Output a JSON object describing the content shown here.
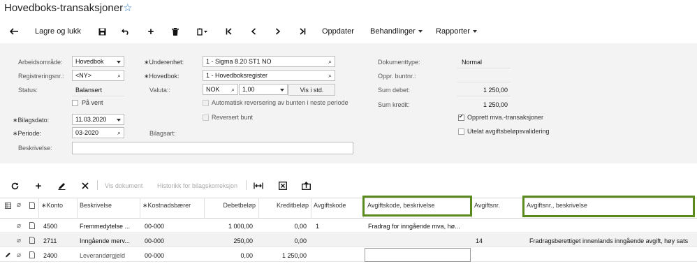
{
  "header": {
    "title": "Hovedboks-transaksjoner"
  },
  "toolbar": {
    "save_close": "Lagre og lukk",
    "update": "Oppdater",
    "actions": "Behandlinger",
    "reports": "Rapporter"
  },
  "form": {
    "workspace_label": "Arbeidsområde:",
    "workspace_value": "Hovedbok",
    "regno_label": "Registreringsnr.:",
    "regno_value": "<NY>",
    "status_label": "Status:",
    "status_value": "Balansert",
    "onhold_label": "På vent",
    "date_label": "Bilagsdato:",
    "date_value": "11.03.2020",
    "period_label": "Periode:",
    "period_value": "03-2020",
    "desc_label": "Beskrivelse:",
    "desc_value": "",
    "subunit_label": "Underenhet:",
    "subunit_value": "1 - Sigma 8.20 ST1 NO",
    "ledger_label": "Hovedbok:",
    "ledger_value": "1 - Hovedboksregister",
    "currency_label": "Valuta::",
    "currency_value": "NOK",
    "rate_value": "1,00",
    "view_std": "Vis i std.",
    "auto_reverse": "Automatisk reversering av bunten i neste periode",
    "reversed": "Reversert bunt",
    "voucher_type_label": "Bilagsart:",
    "doctype_label": "Dokumenttype:",
    "doctype_value": "Normal",
    "orig_batch_label": "Oppr. buntnr.:",
    "orig_batch_value": "",
    "sum_debit_label": "Sum debet:",
    "sum_debit_value": "1 250,00",
    "sum_credit_label": "Sum kredit:",
    "sum_credit_value": "1 250,00",
    "create_vat": "Opprett mva.-transaksjoner",
    "skip_validation": "Utelat avgiftsbeløpsvalidering",
    "create_vat_checked": true,
    "skip_validation_checked": false,
    "onhold_checked": false
  },
  "grid_toolbar": {
    "view_document": "Vis dokument",
    "history": "Historikk for bilagskorreksjon"
  },
  "table": {
    "columns": [
      "Konto",
      "Beskrivelse",
      "Kostnadsbærer",
      "Debetbeløp",
      "Kreditbeløp",
      "Avgiftskode",
      "Avgiftskode, beskrivelse",
      "Avgiftsnr.",
      "Avgiftsnr., beskrivelse"
    ],
    "rows": [
      {
        "account": "4500",
        "desc": "Fremmedytelse ...",
        "cost": "00-000",
        "debit": "1 000,00",
        "credit": "0,00",
        "taxcode": "1",
        "taxcode_desc": "Fradrag for inngående mva, hø...",
        "taxno": "",
        "taxno_desc": ""
      },
      {
        "account": "2711",
        "desc": "Inngående merv...",
        "cost": "00-000",
        "debit": "250,00",
        "credit": "0,00",
        "taxcode": "",
        "taxcode_desc": "",
        "taxno": "14",
        "taxno_desc": "Fradragsberettiget innenlands inngående avgift, høy sats"
      },
      {
        "account": "2400",
        "desc": "Leverandørgjeld",
        "cost": "00-000",
        "debit": "0,00",
        "credit": "1 250,00",
        "taxcode": "",
        "taxcode_desc": "",
        "taxno": "",
        "taxno_desc": ""
      }
    ]
  },
  "colors": {
    "accent": "#2a7fd4",
    "highlight_border": "#5a8a1e",
    "form_bg": "#f3f3f3"
  }
}
